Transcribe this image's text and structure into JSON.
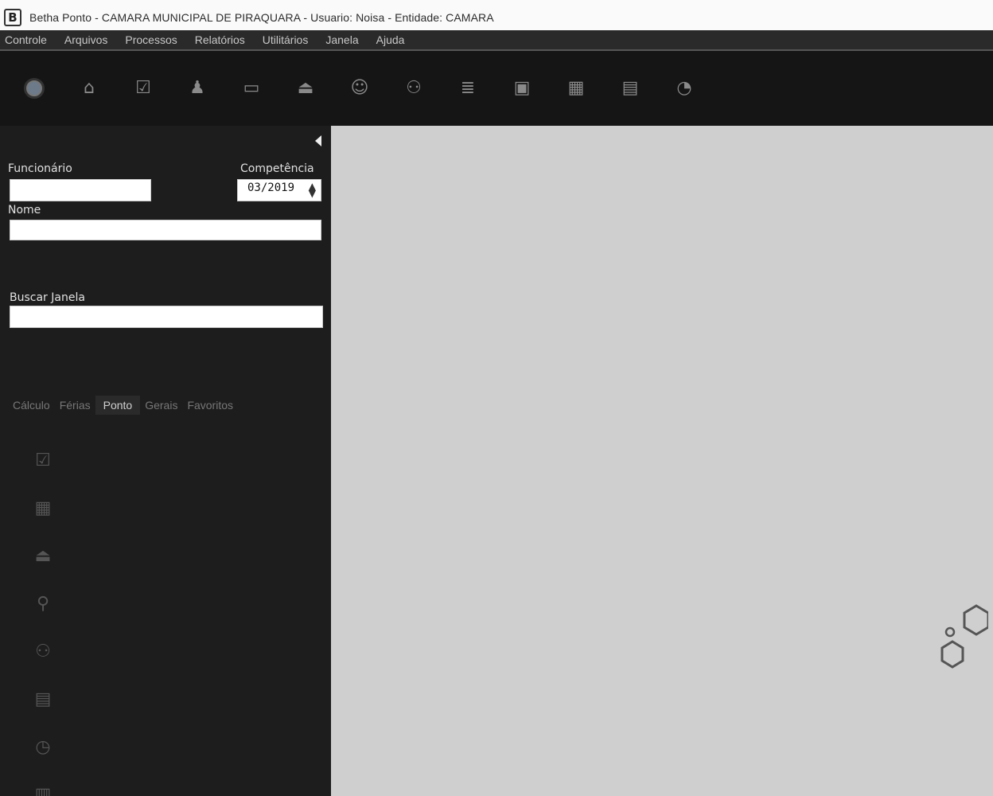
{
  "window": {
    "title": "Betha Ponto - CAMARA MUNICIPAL DE PIRAQUARA - Usuario: Noisa - Entidade: CAMARA",
    "logo_letter": "B"
  },
  "menubar": {
    "items": [
      "Controle",
      "Arquivos",
      "Processos",
      "Relatórios",
      "Utilitários",
      "Janela",
      "Ajuda"
    ]
  },
  "toolbar": {
    "icons": [
      "clock-icon",
      "bank-icon",
      "checkbox-icon",
      "user-icon",
      "card-icon",
      "stamp-icon",
      "user-plus-icon",
      "users-icon",
      "list-icon",
      "calendar-icon",
      "calendar-icon-2",
      "calendar-check-icon",
      "notification-icon"
    ]
  },
  "sidebar": {
    "funcionario_label": "Funcionário",
    "funcionario_value": "",
    "competencia_label": "Competência",
    "competencia_value": "03/2019",
    "nome_label": "Nome",
    "nome_value": "",
    "buscar_label": "Buscar Janela",
    "buscar_value": "",
    "tabs": [
      {
        "label": "Cálculo",
        "active": false
      },
      {
        "label": "Férias",
        "active": false
      },
      {
        "label": "Ponto",
        "active": true
      },
      {
        "label": "Gerais",
        "active": false
      },
      {
        "label": "Favoritos",
        "active": false
      }
    ],
    "features": [
      {
        "icon": "checkbox-icon",
        "label": ""
      },
      {
        "icon": "calendar-icon",
        "label": ""
      },
      {
        "icon": "stamp-icon",
        "label": ""
      },
      {
        "icon": "pin-icon",
        "label": ""
      },
      {
        "icon": "users-icon",
        "label": ""
      },
      {
        "icon": "calendar-grid-icon",
        "label": ""
      },
      {
        "icon": "clock-icon",
        "label": ""
      },
      {
        "icon": "document-icon",
        "label": ""
      }
    ]
  },
  "colors": {
    "menubar_bg": "#2a2a2a",
    "toolbar_bg": "#151515",
    "sidebar_bg": "#1d1d1d",
    "workspace_bg": "#cfcfcf"
  }
}
